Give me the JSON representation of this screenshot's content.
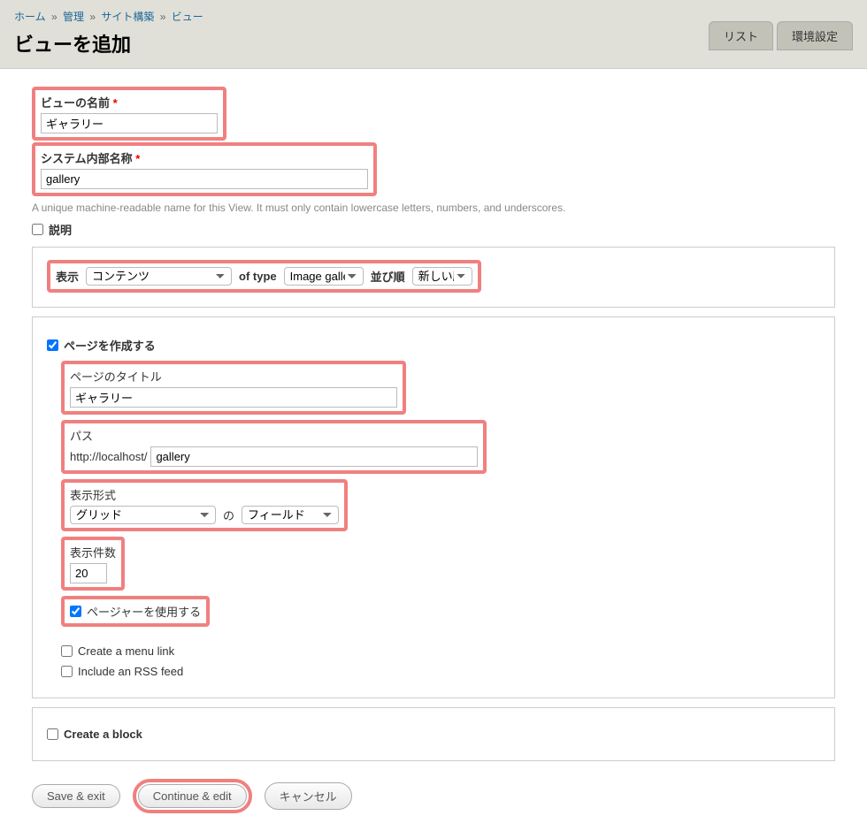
{
  "breadcrumb": {
    "items": [
      "ホーム",
      "管理",
      "サイト構築",
      "ビュー"
    ]
  },
  "page_title": "ビューを追加",
  "tabs": {
    "list": "リスト",
    "settings": "環境設定"
  },
  "fields": {
    "view_name": {
      "label": "ビューの名前",
      "value": "ギャラリー"
    },
    "machine_name": {
      "label": "システム内部名称",
      "value": "gallery",
      "help": "A unique machine-readable name for this View. It must only contain lowercase letters, numbers, and underscores."
    },
    "description": {
      "label": "説明"
    }
  },
  "show": {
    "label": "表示",
    "content_type": "コンテンツ",
    "of_type_label": "of type",
    "of_type_value": "Image gallery",
    "sort_label": "並び順",
    "sort_value": "新しい順"
  },
  "page": {
    "create_label": "ページを作成する",
    "title": {
      "label": "ページのタイトル",
      "value": "ギャラリー"
    },
    "path": {
      "label": "パス",
      "base": "http://localhost/",
      "value": "gallery"
    },
    "format": {
      "label": "表示形式",
      "value": "グリッド",
      "of_label": "の",
      "field_value": "フィールド"
    },
    "items": {
      "label": "表示件数",
      "value": "20"
    },
    "pager": {
      "label": "ページャーを使用する"
    },
    "menu_link": {
      "label": "Create a menu link"
    },
    "rss": {
      "label": "Include an RSS feed"
    }
  },
  "block": {
    "label": "Create a block"
  },
  "buttons": {
    "save_exit": "Save & exit",
    "continue_edit": "Continue & edit",
    "cancel": "キャンセル"
  }
}
